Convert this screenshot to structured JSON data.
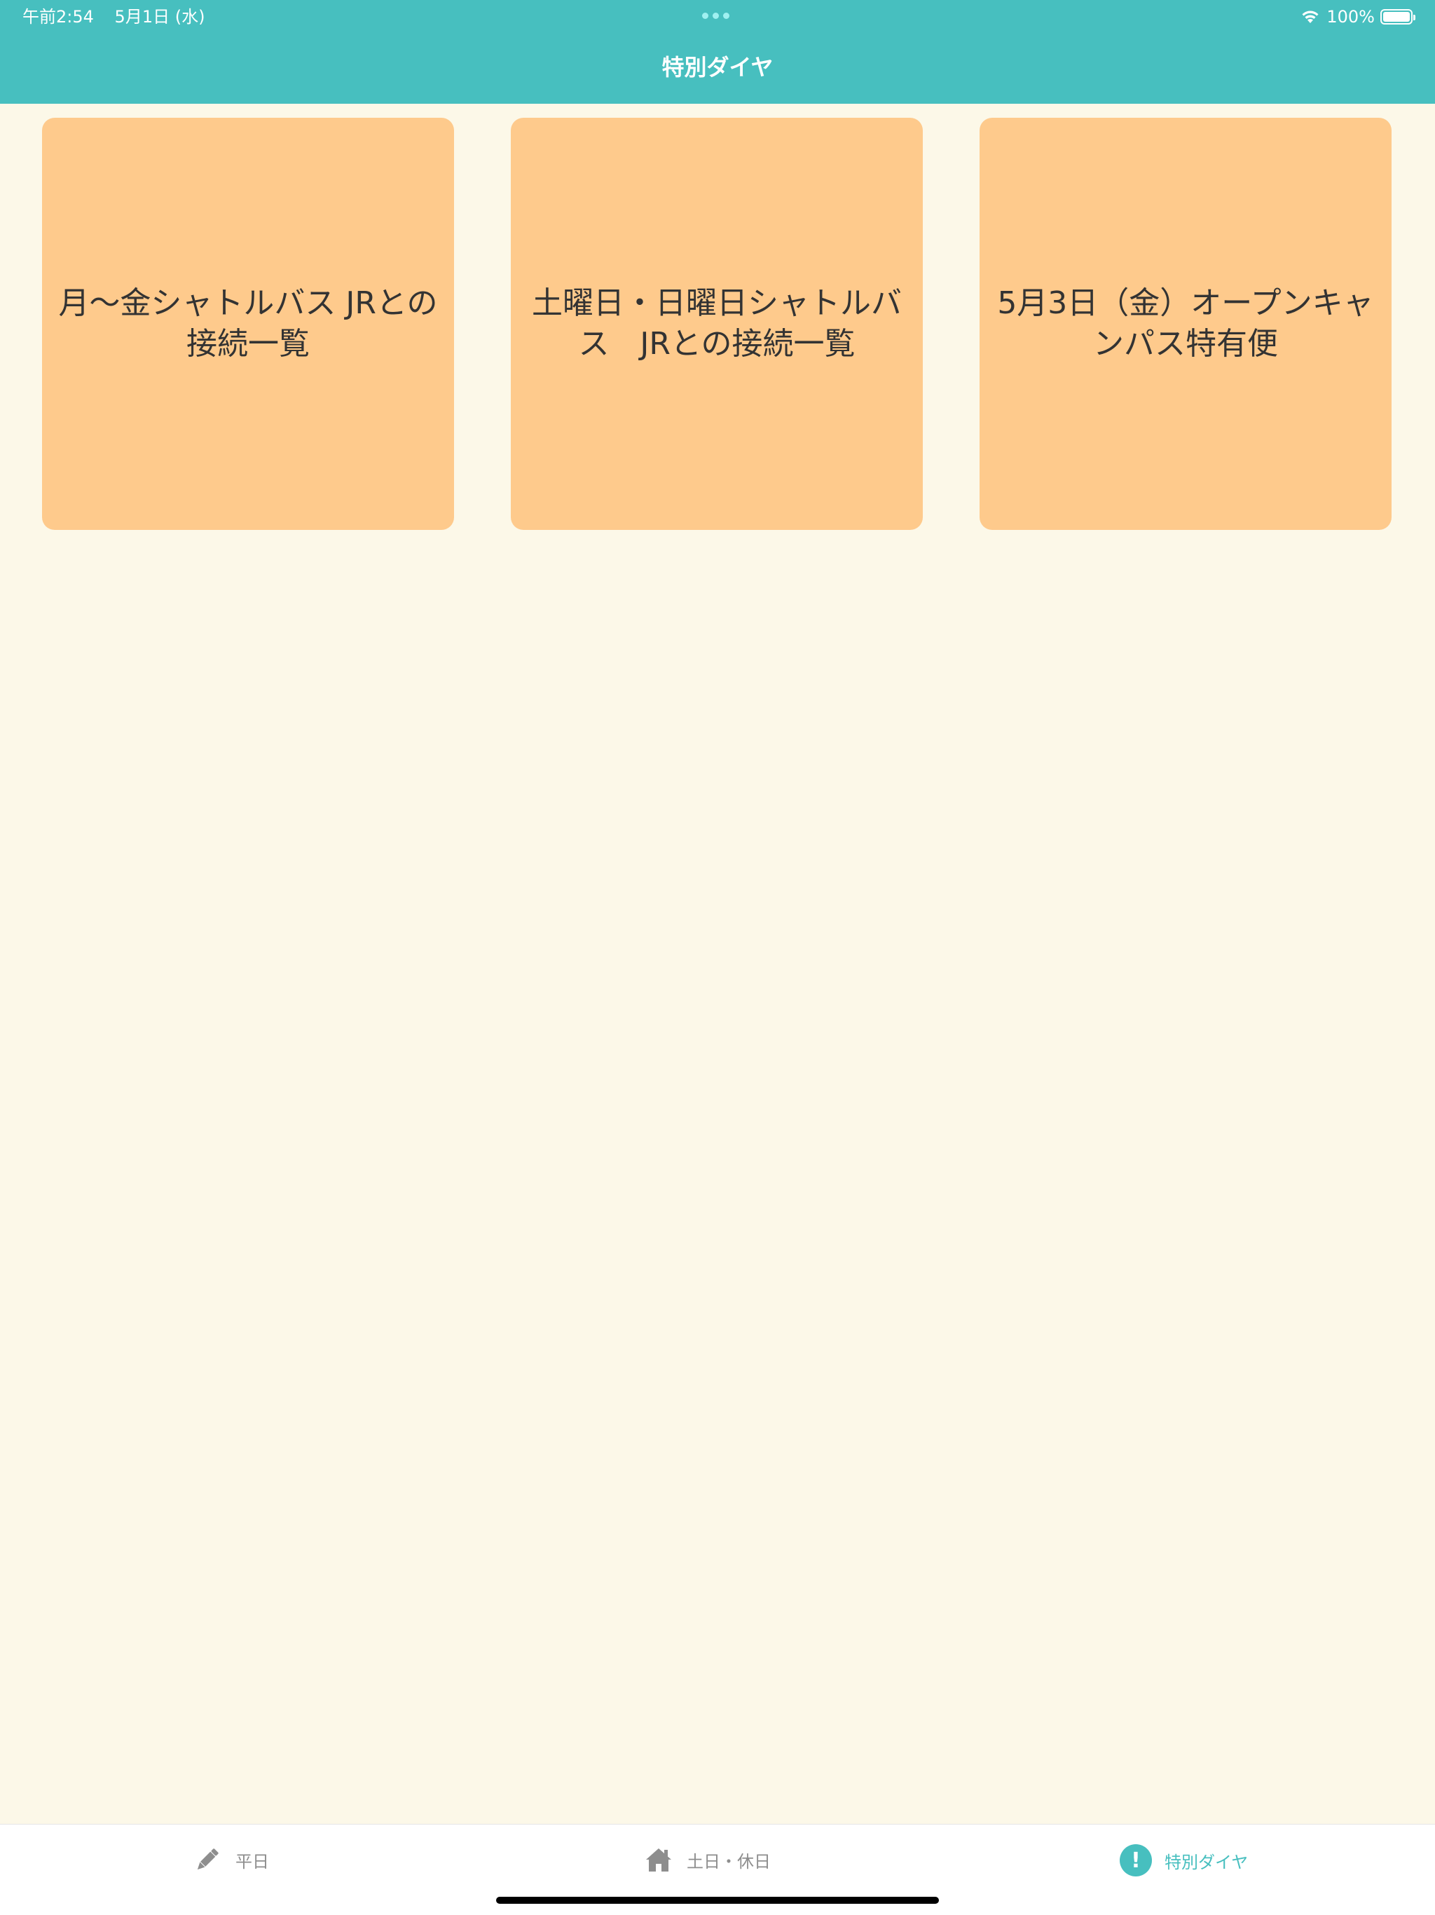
{
  "status_bar": {
    "time": "午前2:54",
    "date": "5月1日 (水)",
    "battery_text": "100%"
  },
  "nav": {
    "title": "特別ダイヤ"
  },
  "tiles": [
    {
      "label_line1": "月〜金シャトルバス JRとの",
      "label_line2": "接続一覧"
    },
    {
      "label_line1": "土曜日・日曜日シャトルバ",
      "label_line2": "ス　JRとの接続一覧"
    },
    {
      "label_line1": "5月3日（金）オープンキャ",
      "label_line2": "ンパス特有便"
    }
  ],
  "tabbar": {
    "items": [
      {
        "label": "平日",
        "icon": "pencil-icon"
      },
      {
        "label": "土日・休日",
        "icon": "home-icon"
      },
      {
        "label": "特別ダイヤ",
        "icon": "exclamation-icon"
      }
    ],
    "active_index": 2
  },
  "colors": {
    "header": "#47BFBF",
    "background": "#FCF8E8",
    "tile": "#FECA8C",
    "text": "#333333",
    "tab_active": "#47BFBF",
    "tab_inactive": "#8E8E8E"
  }
}
